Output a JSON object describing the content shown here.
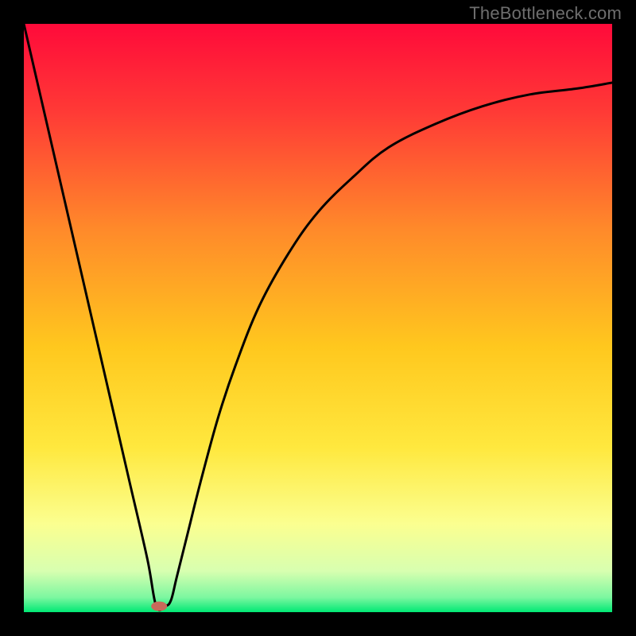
{
  "watermark": "TheBottleneck.com",
  "chart_data": {
    "type": "line",
    "title": "",
    "xlabel": "",
    "ylabel": "",
    "xlim": [
      0,
      100
    ],
    "ylim": [
      0,
      100
    ],
    "grid": false,
    "background": {
      "type": "vertical-gradient",
      "stops": [
        {
          "pos": 0.0,
          "color": "#ff0a3a"
        },
        {
          "pos": 0.15,
          "color": "#ff3a36"
        },
        {
          "pos": 0.35,
          "color": "#ff8a2a"
        },
        {
          "pos": 0.55,
          "color": "#ffc81e"
        },
        {
          "pos": 0.72,
          "color": "#ffe83e"
        },
        {
          "pos": 0.85,
          "color": "#fbff90"
        },
        {
          "pos": 0.93,
          "color": "#d8ffb0"
        },
        {
          "pos": 0.975,
          "color": "#7cf7a0"
        },
        {
          "pos": 1.0,
          "color": "#00e874"
        }
      ]
    },
    "series": [
      {
        "name": "bottleneck-curve",
        "color": "#000000",
        "x": [
          0,
          3,
          6,
          9,
          12,
          15,
          18,
          21,
          22.5,
          24,
          25,
          26,
          28,
          30,
          33,
          36,
          40,
          45,
          50,
          56,
          62,
          70,
          78,
          86,
          94,
          100
        ],
        "values": [
          100,
          87,
          74,
          61,
          48,
          35,
          22,
          9,
          1,
          1,
          2,
          6,
          14,
          22,
          33,
          42,
          52,
          61,
          68,
          74,
          79,
          83,
          86,
          88,
          89,
          90
        ]
      }
    ],
    "marker": {
      "name": "optimal-point",
      "x": 23,
      "y": 1,
      "color": "#c96a5a",
      "rx": 10,
      "ry": 6
    }
  }
}
